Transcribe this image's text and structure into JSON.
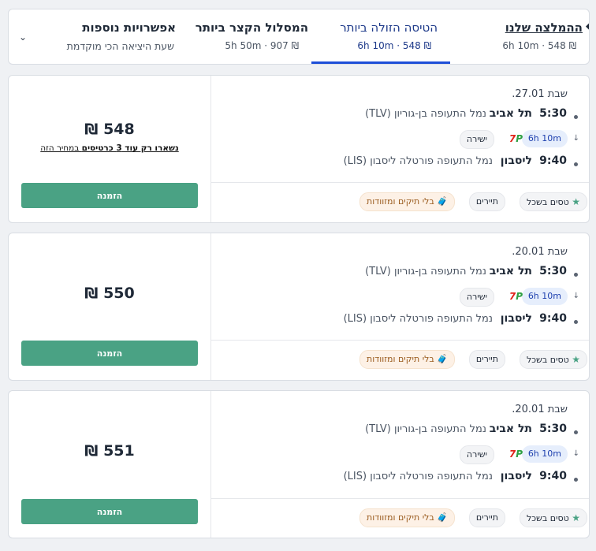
{
  "tabs": {
    "recommended": {
      "title": "ההמלצה שלנו",
      "sub": "₪ 548 · 6h 10m"
    },
    "cheapest": {
      "title": "הטיסה הזולה ביותר",
      "sub": "₪ 548 · 6h 10m"
    },
    "shortest": {
      "title": "המסלול הקצר ביותר",
      "sub": "₪ 907 · 5h 50m"
    },
    "more": {
      "title": "אפשרויות נוספות",
      "sub": "שעת היציאה הכי מוקדמת"
    }
  },
  "flights": [
    {
      "date": "שבת 27.01.",
      "dep_time": "5:30",
      "dep_city": "תל אביב",
      "dep_airport": "נמל התעופה בן-גוריון (TLV)",
      "duration": "6h 10m",
      "airline_logo": "TP",
      "stops": "ישירה",
      "arr_time": "9:40",
      "arr_city": "ליסבון",
      "arr_airport": "נמל התעופה פורטלה ליסבון (LIS)",
      "tags": [
        "טסים בשכל",
        "תיירים",
        "בלי תיקים ומזוודות"
      ],
      "price": "548 ₪",
      "warn_bold": "נשארו רק עוד 3 כרטיסים",
      "warn_rest": " במחיר הזה",
      "book": "הזמנה"
    },
    {
      "date": "שבת 20.01.",
      "dep_time": "5:30",
      "dep_city": "תל אביב",
      "dep_airport": "נמל התעופה בן-גוריון (TLV)",
      "duration": "6h 10m",
      "airline_logo": "TP",
      "stops": "ישירה",
      "arr_time": "9:40",
      "arr_city": "ליסבון",
      "arr_airport": "נמל התעופה פורטלה ליסבון (LIS)",
      "tags": [
        "טסים בשכל",
        "תיירים",
        "בלי תיקים ומזוודות"
      ],
      "price": "550 ₪",
      "book": "הזמנה"
    },
    {
      "date": "שבת 20.01.",
      "dep_time": "5:30",
      "dep_city": "תל אביב",
      "dep_airport": "נמל התעופה בן-גוריון (TLV)",
      "duration": "6h 10m",
      "airline_logo": "TP",
      "stops": "ישירה",
      "arr_time": "9:40",
      "arr_city": "ליסבון",
      "arr_airport": "נמל התעופה פורטלה ליסבון (LIS)",
      "tags": [
        "טסים בשכל",
        "תיירים",
        "בלי תיקים ומזוודות"
      ],
      "price": "551 ₪",
      "book": "הזמנה"
    }
  ],
  "colors": {
    "accent": "#4aa284",
    "active_tab": "#1d4ed8",
    "duration_bg": "#e6eefc"
  },
  "icons": {
    "recommended": "bookmark-icon",
    "dropdown": "chevron-down-icon",
    "tag_star": "star-icon",
    "tag_bag": "bag-icon",
    "arrow": "arrow-down-icon"
  }
}
